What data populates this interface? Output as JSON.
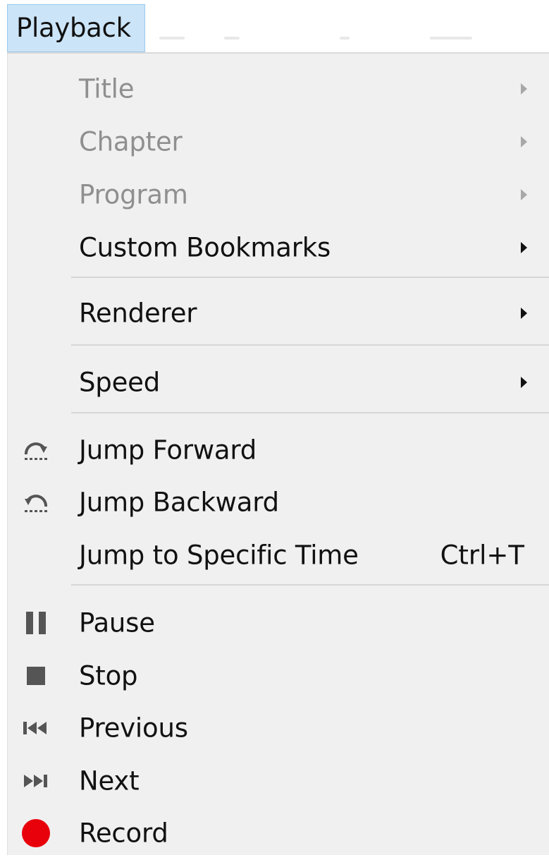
{
  "menubar": {
    "active_menu": "Playback"
  },
  "menu": {
    "items": [
      {
        "label": "Title",
        "disabled": true,
        "submenu": true
      },
      {
        "label": "Chapter",
        "disabled": true,
        "submenu": true
      },
      {
        "label": "Program",
        "disabled": true,
        "submenu": true
      },
      {
        "label": "Custom Bookmarks",
        "disabled": false,
        "submenu": true
      },
      {
        "label": "Renderer",
        "disabled": false,
        "submenu": true
      },
      {
        "label": "Speed",
        "disabled": false,
        "submenu": true
      },
      {
        "label": "Jump Forward",
        "icon": "jump-forward-icon"
      },
      {
        "label": "Jump Backward",
        "icon": "jump-backward-icon"
      },
      {
        "label": "Jump to Specific Time",
        "shortcut": "Ctrl+T"
      },
      {
        "label": "Pause",
        "icon": "pause-icon"
      },
      {
        "label": "Stop",
        "icon": "stop-icon"
      },
      {
        "label": "Previous",
        "icon": "previous-icon"
      },
      {
        "label": "Next",
        "icon": "next-icon"
      },
      {
        "label": "Record",
        "icon": "record-icon"
      }
    ]
  },
  "colors": {
    "menubar_highlight": "#cce4f7",
    "menu_background": "#f0f0f0",
    "disabled_text": "#8f8f8f",
    "record_red": "#e8000b"
  }
}
